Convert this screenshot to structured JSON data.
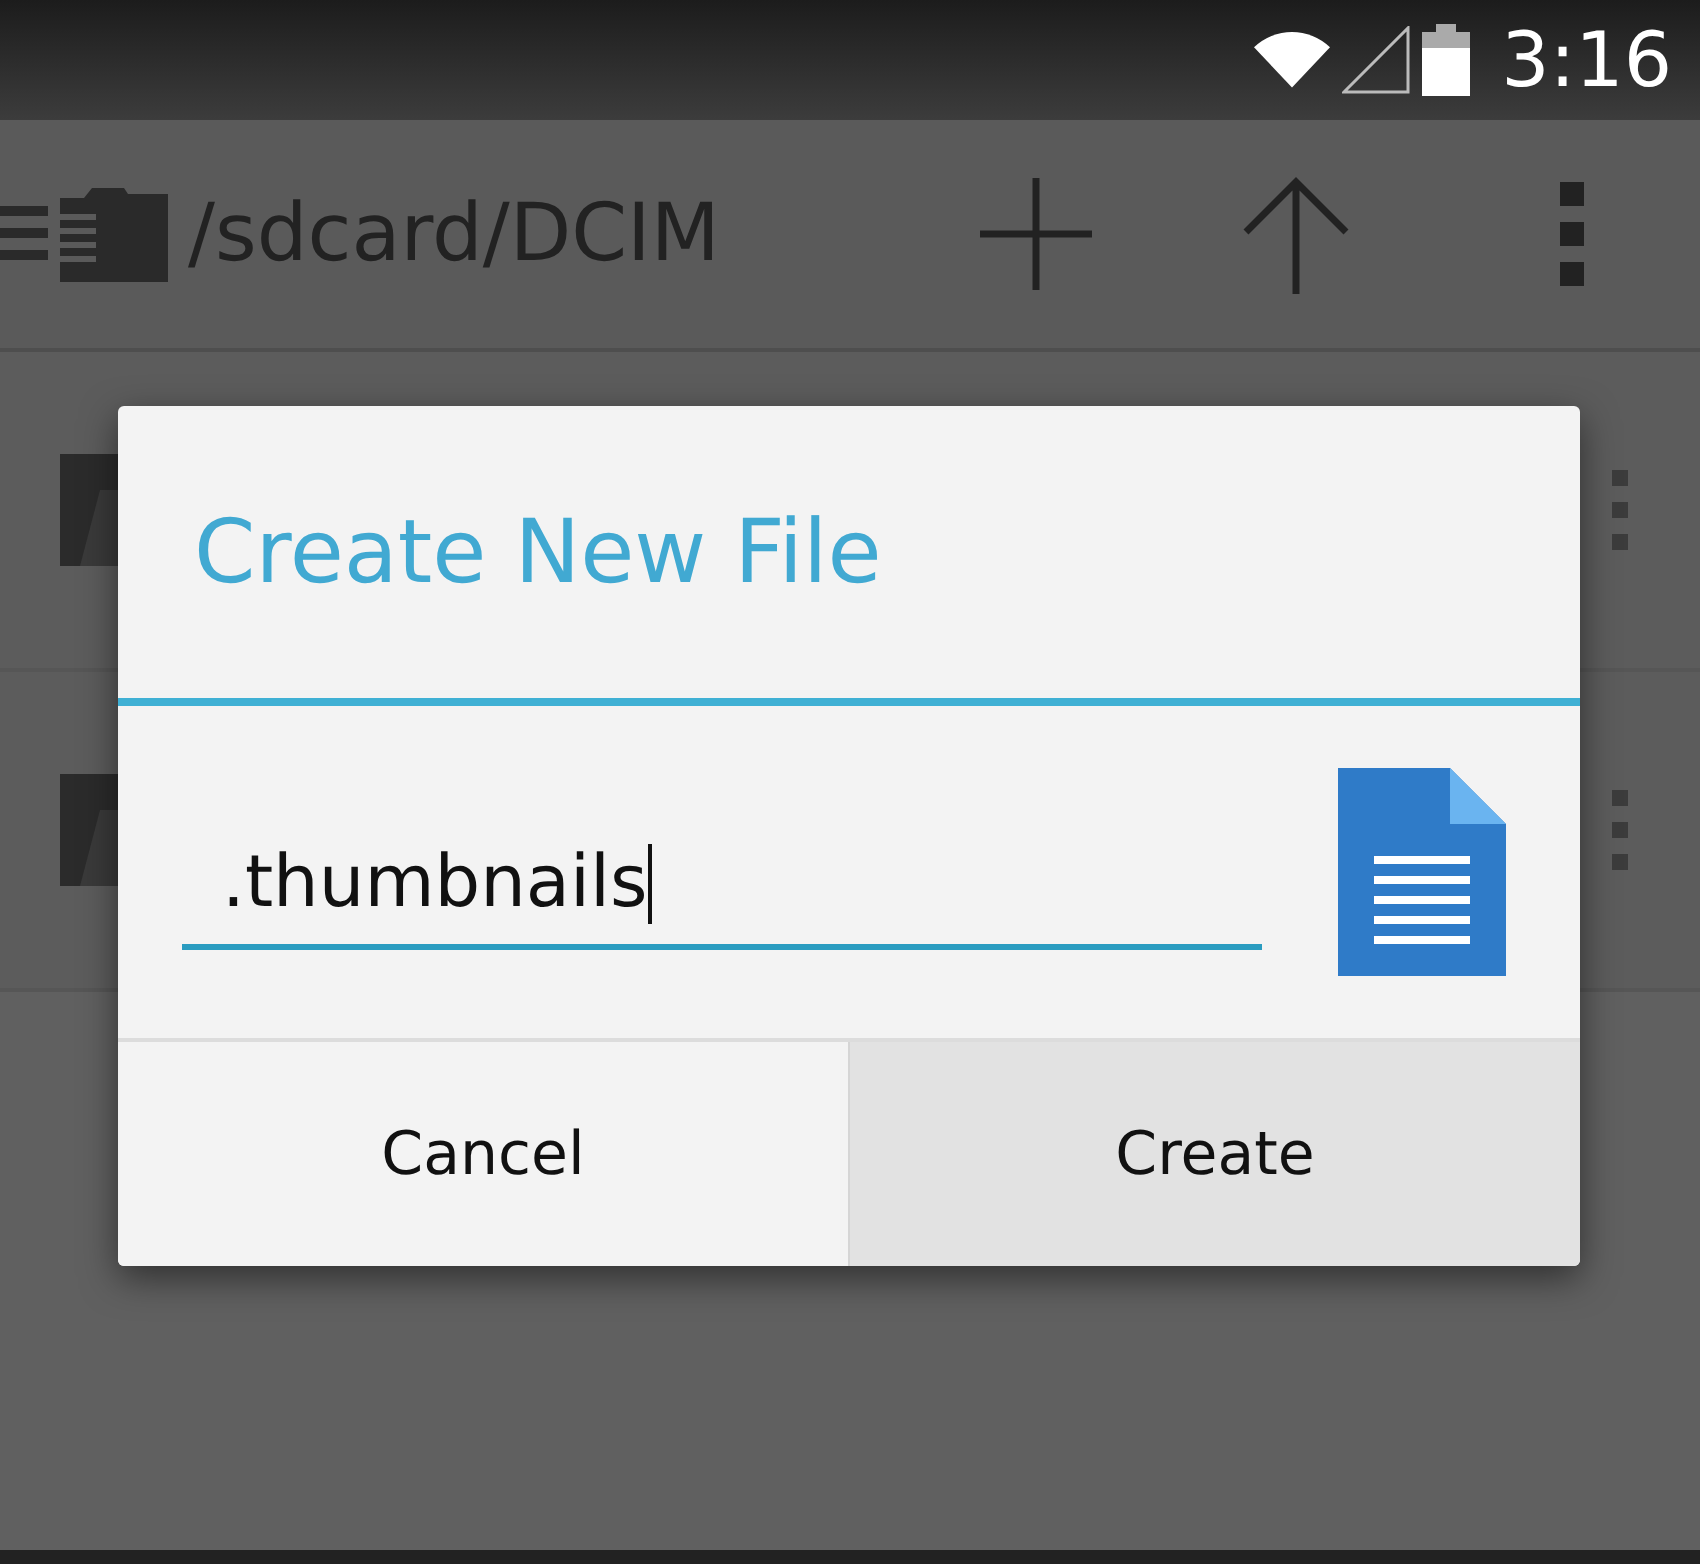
{
  "status_bar": {
    "time": "3:16"
  },
  "toolbar": {
    "path": "/sdcard/DCIM"
  },
  "list": {
    "rows": [
      {
        "kind": "folder"
      },
      {
        "kind": "folder"
      }
    ]
  },
  "dialog": {
    "title": "Create New File",
    "field": {
      "value": ".thumbnails",
      "focused": true
    },
    "buttons": [
      {
        "label": "Cancel",
        "pressed": false
      },
      {
        "label": "Create",
        "pressed": true
      }
    ]
  }
}
